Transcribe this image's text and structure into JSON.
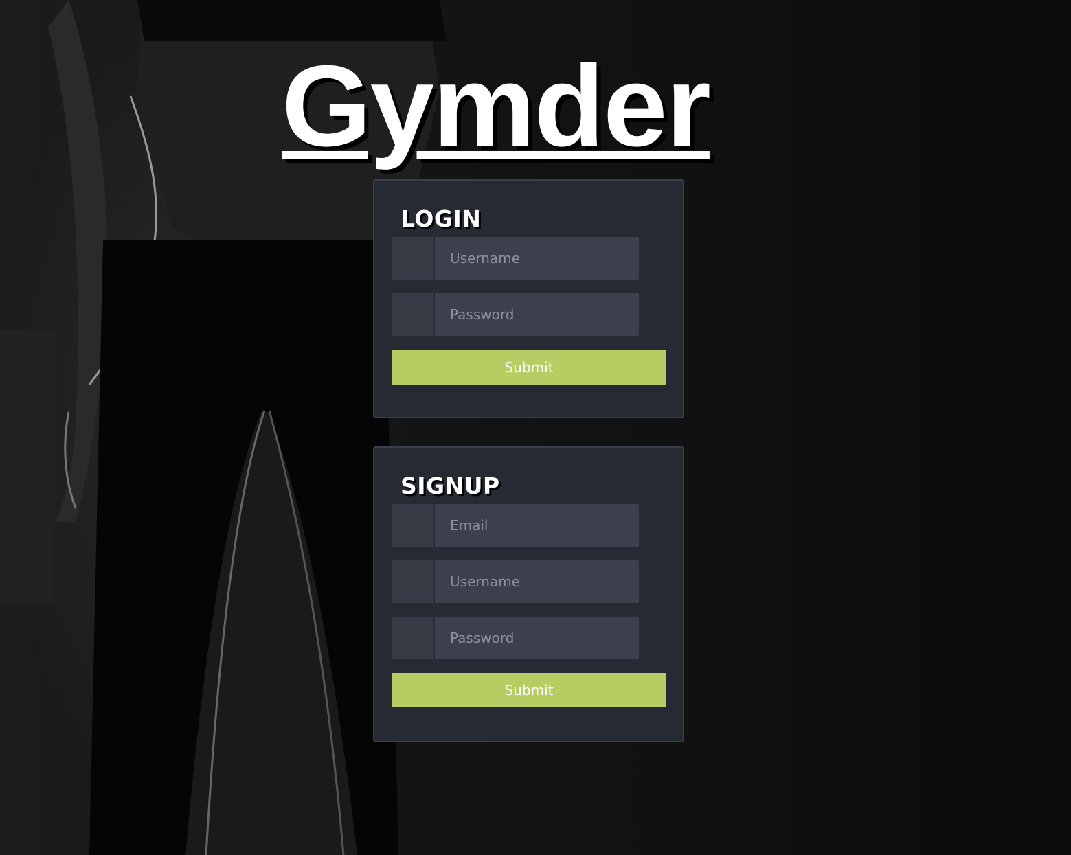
{
  "app": {
    "title": "Gymder"
  },
  "login": {
    "heading": "LOGIN",
    "username_placeholder": "Username",
    "password_placeholder": "Password",
    "submit_label": "Submit"
  },
  "signup": {
    "heading": "SIGNUP",
    "email_placeholder": "Email",
    "username_placeholder": "Username",
    "password_placeholder": "Password",
    "submit_label": "Submit"
  },
  "colors": {
    "panel": "#262a33",
    "input": "#3b404c",
    "icon_cell": "#363b46",
    "accent": "#b7cd63"
  }
}
